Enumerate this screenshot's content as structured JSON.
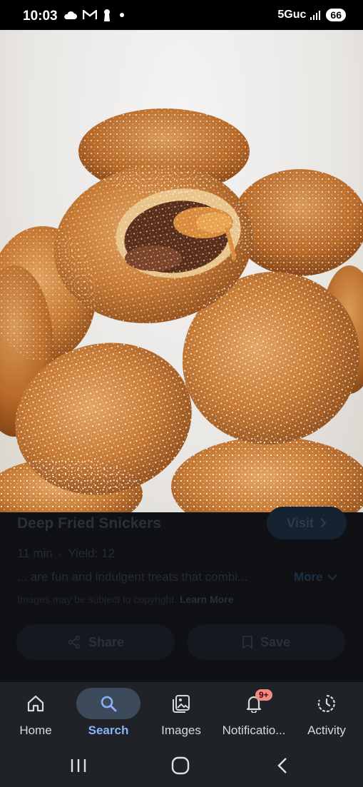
{
  "status": {
    "time": "10:03",
    "network": "5Guc",
    "battery": "66"
  },
  "result": {
    "title": "Deep Fried Snickers",
    "visit_label": "Visit",
    "time": "11 min",
    "separator": "·",
    "yield": "Yield: 12",
    "description": "... are fun and indulgent treats that combi...",
    "more_label": "More",
    "copyright": "Images may be subject to copyright.",
    "learn_more": "Learn More",
    "share_label": "Share",
    "save_label": "Save"
  },
  "nav": {
    "items": [
      {
        "label": "Home",
        "icon": "home-icon"
      },
      {
        "label": "Search",
        "icon": "search-icon"
      },
      {
        "label": "Images",
        "icon": "images-icon"
      },
      {
        "label": "Notificatio...",
        "icon": "bell-icon",
        "badge": "9+"
      },
      {
        "label": "Activity",
        "icon": "activity-icon"
      }
    ],
    "active": "Search"
  },
  "colors": {
    "accent": "#8ab4f8",
    "nav_background": "#1f2328",
    "badge": "#f28b82"
  }
}
